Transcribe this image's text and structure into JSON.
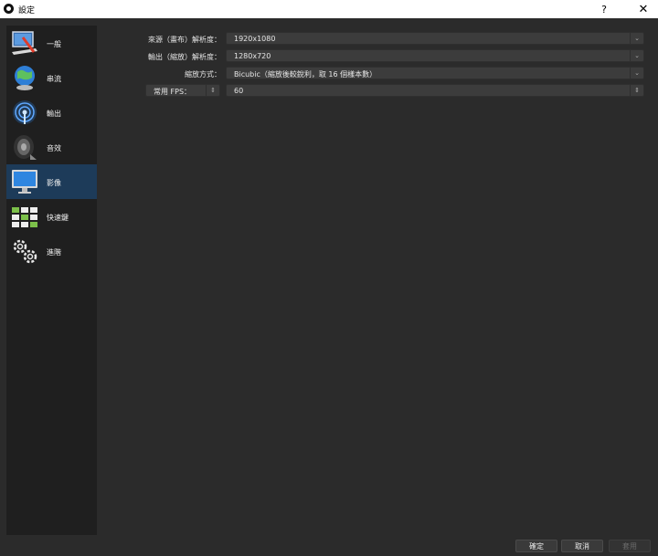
{
  "window": {
    "title": "設定",
    "help_label": "?",
    "close_label": "✕"
  },
  "sidebar": {
    "items": [
      {
        "label": "一般",
        "icon": "general-settings-icon",
        "selected": false
      },
      {
        "label": "串流",
        "icon": "stream-globe-icon",
        "selected": false
      },
      {
        "label": "輸出",
        "icon": "output-broadcast-icon",
        "selected": false
      },
      {
        "label": "音效",
        "icon": "audio-speaker-icon",
        "selected": false
      },
      {
        "label": "影像",
        "icon": "video-monitor-icon",
        "selected": true
      },
      {
        "label": "快速鍵",
        "icon": "hotkeys-keyboard-icon",
        "selected": false
      },
      {
        "label": "進階",
        "icon": "advanced-gears-icon",
        "selected": false
      }
    ]
  },
  "video": {
    "base_resolution": {
      "label": "來源（畫布）解析度：",
      "value": "1920x1080"
    },
    "output_resolution": {
      "label": "輸出（縮放）解析度：",
      "value": "1280x720"
    },
    "downscale_filter": {
      "label": "縮放方式：",
      "value": "Bicubic（縮放後較銳利，取 16 個樣本數）"
    },
    "fps": {
      "type_value": "常用 FPS：",
      "value": "60"
    }
  },
  "footer": {
    "ok_label": "確定",
    "cancel_label": "取消",
    "apply_label": "套用"
  },
  "colors": {
    "background": "#2b2b2b",
    "sidebar": "#1f1f1f",
    "selected": "#1d3b59",
    "field": "#3c3c3c"
  }
}
